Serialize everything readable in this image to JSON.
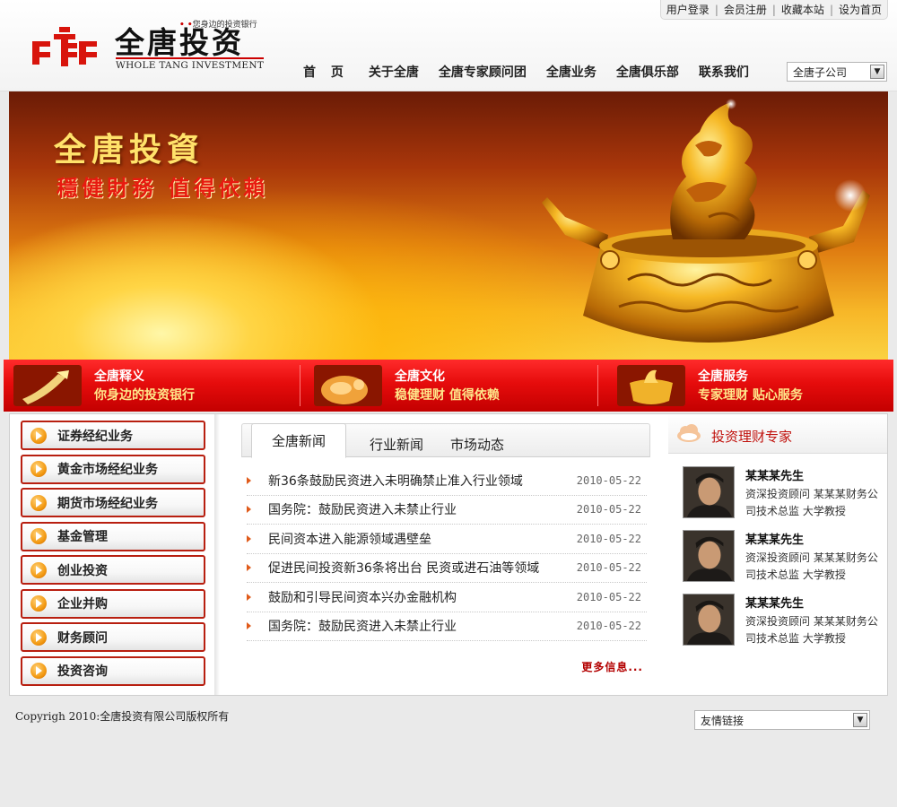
{
  "top_links": [
    "用户登录",
    "会员注册",
    "收藏本站",
    "设为首页"
  ],
  "logo": {
    "name": "全唐投资",
    "english": "WHOLE TANG INVESTMENT",
    "slogan": "您身边的投资银行"
  },
  "nav": [
    "首 页",
    "关于全唐",
    "全唐专家顾问团",
    "全唐业务",
    "全唐俱乐部",
    "联系我们"
  ],
  "subsidiary_select": {
    "selected": "全唐子公司"
  },
  "banner": {
    "title": "全唐投資",
    "subtitle": "穩健財務  值得依賴"
  },
  "features": [
    {
      "title": "全唐释义",
      "subtitle": "你身边的投资银行"
    },
    {
      "title": "全唐文化",
      "subtitle": "稳健理财 值得依赖"
    },
    {
      "title": "全唐服务",
      "subtitle": "专家理财 贴心服务"
    }
  ],
  "side_menu": [
    "证券经纪业务",
    "黄金市场经纪业务",
    "期货市场经纪业务",
    "基金管理",
    "创业投资",
    "企业并购",
    "财务顾问",
    "投资咨询"
  ],
  "news": {
    "tabs": [
      "全唐新闻",
      "行业新闻",
      "市场动态"
    ],
    "active_tab": 0,
    "items": [
      {
        "title": "新36条鼓励民资进入未明确禁止准入行业领域",
        "date": "2010-05-22"
      },
      {
        "title": "国务院：鼓励民资进入未禁止行业",
        "date": "2010-05-22"
      },
      {
        "title": "民间资本进入能源领域遇壁垒",
        "date": "2010-05-22"
      },
      {
        "title": "促进民间投资新36条将出台 民资或进石油等领域",
        "date": "2010-05-22"
      },
      {
        "title": "鼓励和引导民间资本兴办金融机构",
        "date": "2010-05-22"
      },
      {
        "title": "国务院：鼓励民资进入未禁止行业",
        "date": "2010-05-22"
      }
    ],
    "more": "更多信息..."
  },
  "experts": {
    "title": "投资理财专家",
    "items": [
      {
        "name": "某某某先生",
        "desc": "资深投资顾问 某某某财务公司技术总监 大学教授"
      },
      {
        "name": "某某某先生",
        "desc": "资深投资顾问 某某某财务公司技术总监 大学教授"
      },
      {
        "name": "某某某先生",
        "desc": "资深投资顾问 某某某财务公司技术总监 大学教授"
      }
    ]
  },
  "footer": {
    "copyright": "Copyrigh 2010:全唐投资有限公司版权所有",
    "links_select": {
      "selected": "友情链接"
    }
  },
  "colors": {
    "brand_red": "#c0100b",
    "accent_gold": "#ffe26a"
  }
}
